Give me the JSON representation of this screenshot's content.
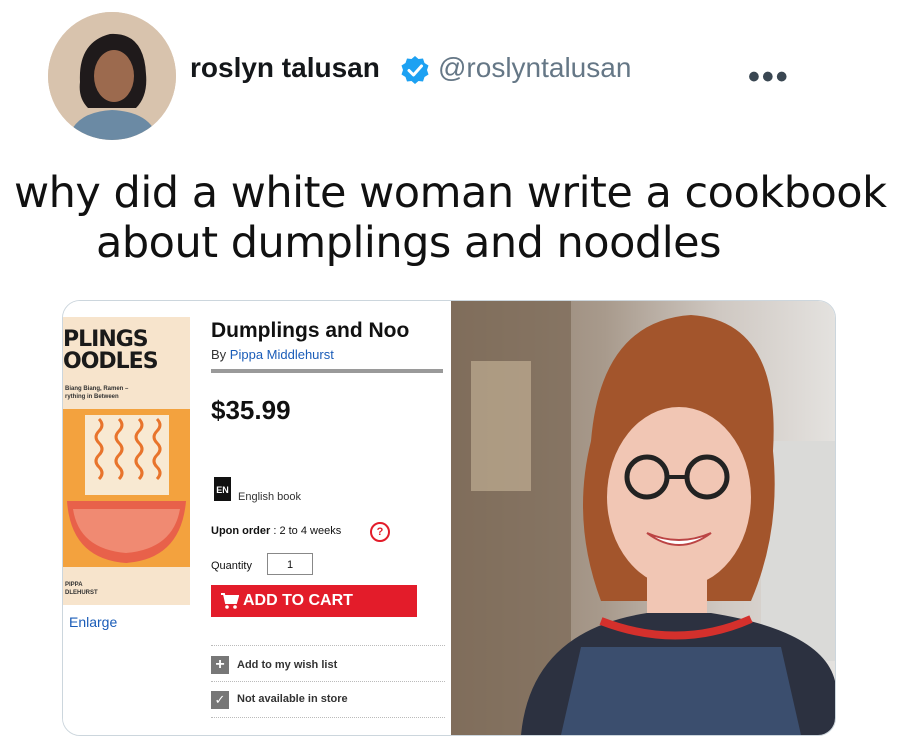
{
  "tweet": {
    "display_name": "roslyn talusan",
    "handle": "@roslyntalusan",
    "more_label": "•••",
    "text_line1": "why did a white woman write a cookbook",
    "text_line2": "about dumplings and noodles"
  },
  "product": {
    "cover_title": "PLINGS\nOODLES",
    "cover_subtitle": "Biang Biang, Ramen –\nrything in Between",
    "cover_author": "PIPPA\nDLEHURST",
    "enlarge_label": "Enlarge",
    "title": "Dumplings and Noo",
    "by_prefix": "By ",
    "author": "Pippa Middlehurst",
    "price": "$35.99",
    "lang_icon": "EN",
    "language": "English book",
    "upon_label": "Upon order",
    "upon_value": " : 2 to 4 weeks",
    "help_icon": "?",
    "quantity_label": "Quantity",
    "quantity_value": "1",
    "add_to_cart": "ADD TO CART",
    "wish_icon": "+",
    "wish_label": "Add to my wish list",
    "store_icon": "✓",
    "store_label": "Not available in store"
  },
  "colors": {
    "verified": "#1da1f2",
    "cart": "#e31c2a",
    "link": "#1a5cb8",
    "handle": "#657786"
  }
}
